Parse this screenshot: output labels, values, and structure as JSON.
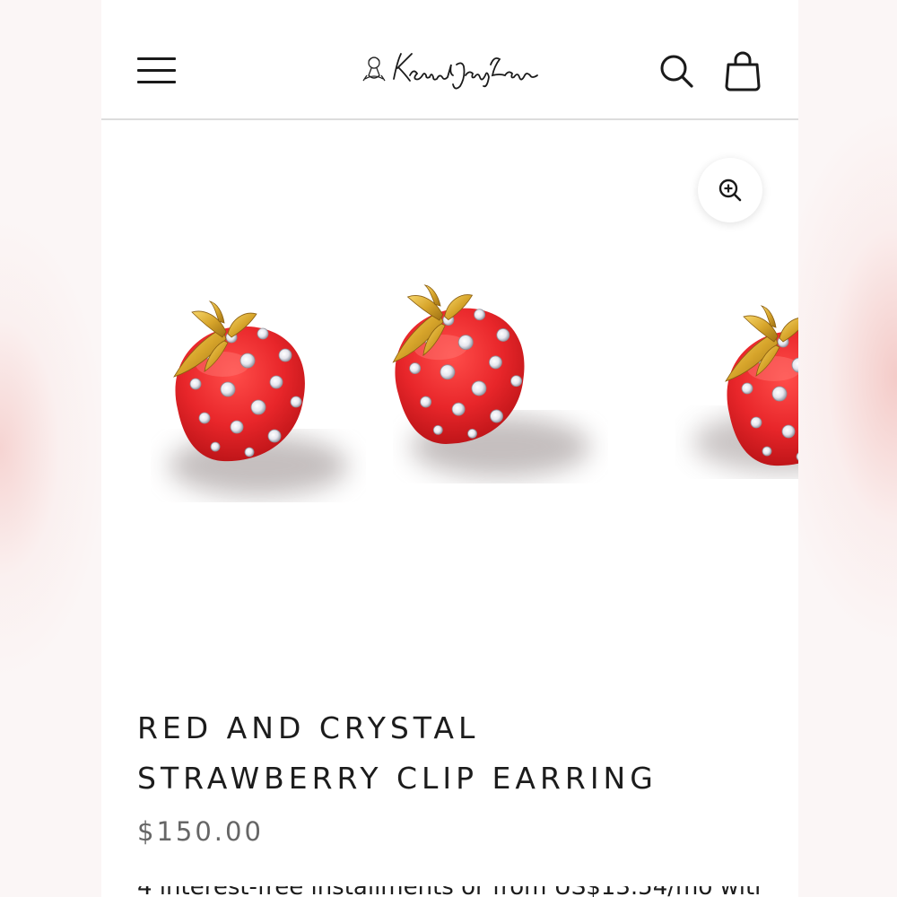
{
  "header": {
    "brand": "Kenneth Jay Lane"
  },
  "product": {
    "title_line1": "RED AND CRYSTAL",
    "title_line2": "STRAWBERRY CLIP EARRING",
    "price": "$150.00",
    "description_partial": "4 interest-free installments or from US$13.54/mo with"
  },
  "colors": {
    "strawberry_red": "#e8262a",
    "gold": "#d7a52b",
    "text": "#1c1c1c",
    "price_gray": "#666666"
  },
  "icons": [
    "menu-icon",
    "search-icon",
    "shopping-bag-icon",
    "zoom-in-icon"
  ]
}
